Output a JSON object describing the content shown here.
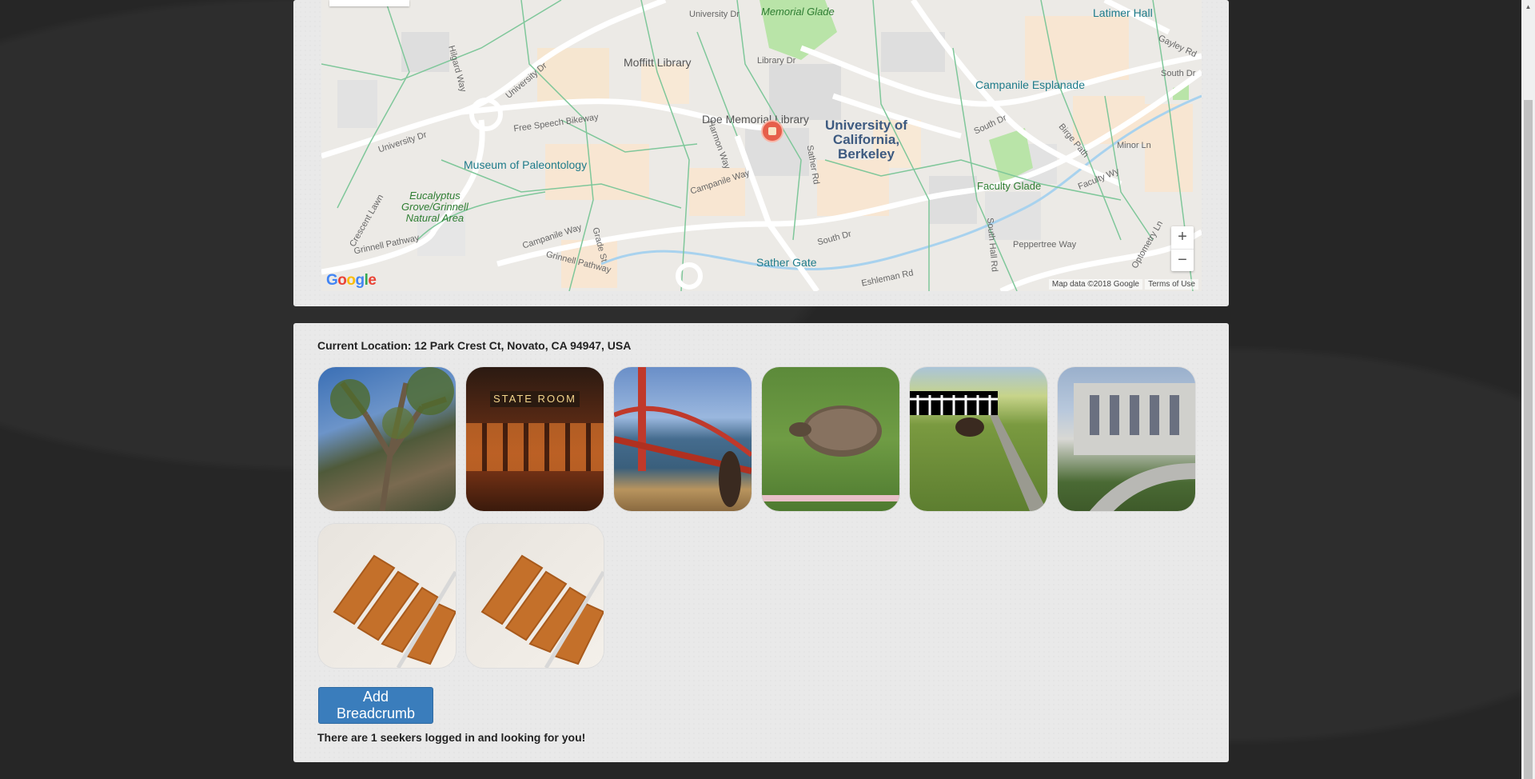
{
  "map": {
    "labels": {
      "memorial_glade": "Memorial\nGlade",
      "latimer_hall": "Latimer Hall",
      "moffitt_library": "Moffitt Library",
      "campanile_esplanade": "Campanile Esplanade",
      "doe_library": "Doe Memorial Library",
      "uc_berkeley": "University of\nCalifornia,\nBerkeley",
      "free_speech": "Free Speech Bikeway",
      "museum": "Museum of Paleontology",
      "eucalyptus": "Eucalyptus\nGrove/Grinnell\nNatural Area",
      "faculty_glade": "Faculty Glade",
      "sather_gate": "Sather Gate",
      "university_dr_1": "University Dr",
      "university_dr_2": "University Dr",
      "university_dr_3": "University Dr",
      "library_dr": "Library Dr",
      "campanile_way": "Campanile Way",
      "campanile_way_2": "Campanile Way",
      "grinnell_pathway": "Grinnell Pathway",
      "grinnell_pathway_2": "Grinnell Pathway",
      "south_dr": "South Dr",
      "south_dr_2": "South Dr",
      "eshleman_rd": "Eshleman Rd",
      "peppertree_way": "Peppertree Way",
      "faculty_wy": "Faculty Wy",
      "minor_ln": "Minor Ln",
      "gayley_rd": "Gayley Rd",
      "south_dr_3": "South Dr",
      "sather_rd": "Sather Rd",
      "harmon_way": "Harmon Way",
      "grade_st": "Grade St",
      "hilgard_way": "Hilgard Way",
      "crescent_lawn": "Crescent Lawn",
      "optometry_ln": "Optometry Ln",
      "south_hall_rd": "South Hall Rd",
      "birge_path": "Birge Path"
    },
    "google_logo": "Google",
    "attribution": "Map data ©2018 Google",
    "terms": "Terms of Use",
    "zoom_in": "+",
    "zoom_out": "−"
  },
  "location": {
    "text": "Current Location: 12 Park Crest Ct, Novato, CA 94947, USA"
  },
  "photos": [
    {
      "name": "tree",
      "label": "tree"
    },
    {
      "name": "state-room",
      "label": "STATE ROOM"
    },
    {
      "name": "golden-gate",
      "label": "golden gate"
    },
    {
      "name": "tortoise",
      "label": "tortoise"
    },
    {
      "name": "turkey",
      "label": "turkey"
    },
    {
      "name": "library-building",
      "label": "library"
    },
    {
      "name": "bread-1",
      "label": "bread"
    },
    {
      "name": "bread-2",
      "label": "bread"
    }
  ],
  "actions": {
    "add_breadcrumb": "Add Breadcrumb"
  },
  "status": {
    "seekers": "There are 1 seekers logged in and looking for you!"
  },
  "colors": {
    "accent": "#3a7dbc",
    "background": "#262626",
    "panel": "#e9e9e9"
  }
}
